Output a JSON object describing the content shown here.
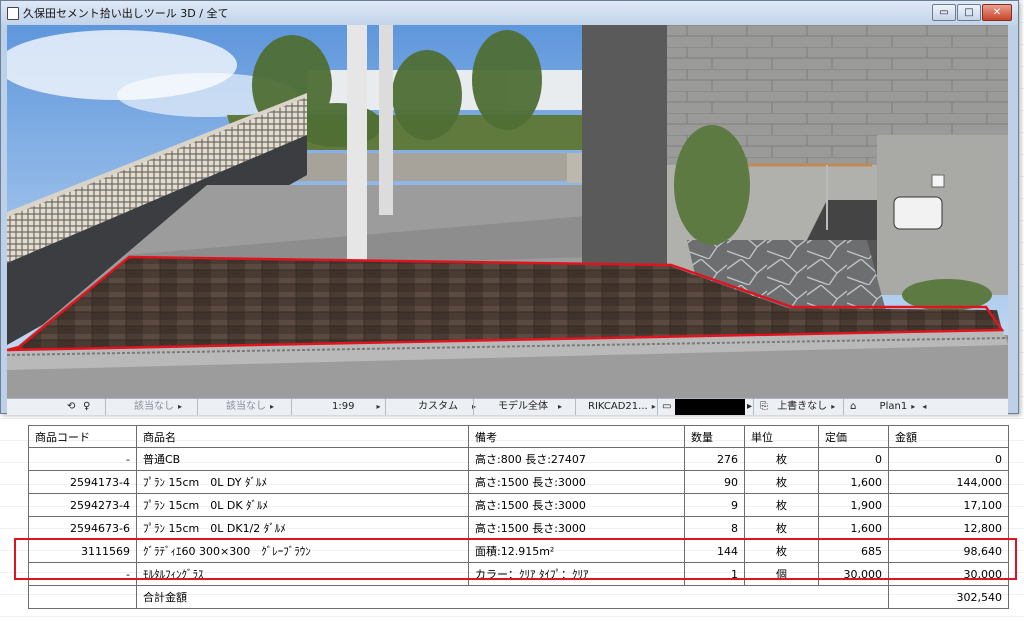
{
  "window": {
    "title": "久保田セメント拾い出しツール 3D / 全て",
    "buttons": {
      "minimize": "▭",
      "maximize": "□",
      "close": "✕"
    }
  },
  "statusbar": {
    "left_icons": [
      "⟲",
      "♀"
    ],
    "items": [
      {
        "label": "該当なし",
        "dim": true
      },
      {
        "label": "該当なし",
        "dim": true
      },
      {
        "label": "1:99",
        "dim": false
      },
      {
        "label": "カスタム",
        "dim": false
      },
      {
        "label": "モデル全体",
        "dim": false
      },
      {
        "label": "RIKCAD21...",
        "dim": false
      },
      {
        "label": "上書きなし",
        "dim": false
      },
      {
        "label": "Plan1",
        "dim": false
      }
    ],
    "arrow": "▸"
  },
  "table": {
    "headers": [
      "商品コード",
      "商品名",
      "備考",
      "数量",
      "単位",
      "定価",
      "金額"
    ],
    "rows": [
      [
        "-",
        "普通CB",
        "高さ:800 長さ:27407",
        "276",
        "枚",
        "0",
        "0"
      ],
      [
        "2594173-4",
        "ﾌﾟﾗﾝ 15cm　0L DY ﾀﾞﾙﾒ",
        "高さ:1500 長さ:3000",
        "90",
        "枚",
        "1,600",
        "144,000"
      ],
      [
        "2594273-4",
        "ﾌﾟﾗﾝ 15cm　0L DK ﾀﾞﾙﾒ",
        "高さ:1500 長さ:3000",
        "9",
        "枚",
        "1,900",
        "17,100"
      ],
      [
        "2594673-6",
        "ﾌﾟﾗﾝ 15cm　0L DK1/2 ﾀﾞﾙﾒ",
        "高さ:1500 長さ:3000",
        "8",
        "枚",
        "1,600",
        "12,800"
      ],
      [
        "3111569",
        "ｸﾞﾗﾃﾞｨｴ60 300×300　ｸﾞﾚｰﾌﾞﾗｳﾝ",
        "面積:12.915m²",
        "144",
        "枚",
        "685",
        "98,640"
      ],
      [
        "-",
        "ﾓﾙﾀﾙﾌｨﾝｸﾞﾗｽ",
        "カラー：ｸﾘｱ ﾀｲﾌﾟ：ｸﾘｱ",
        "1",
        "個",
        "30,000",
        "30,000"
      ]
    ],
    "total_label": "合計金額",
    "total_value": "302,540"
  },
  "colors": {
    "highlight": "#e0141e",
    "titlebar": "#c2d4ea",
    "sky": "#8ab2e6"
  }
}
